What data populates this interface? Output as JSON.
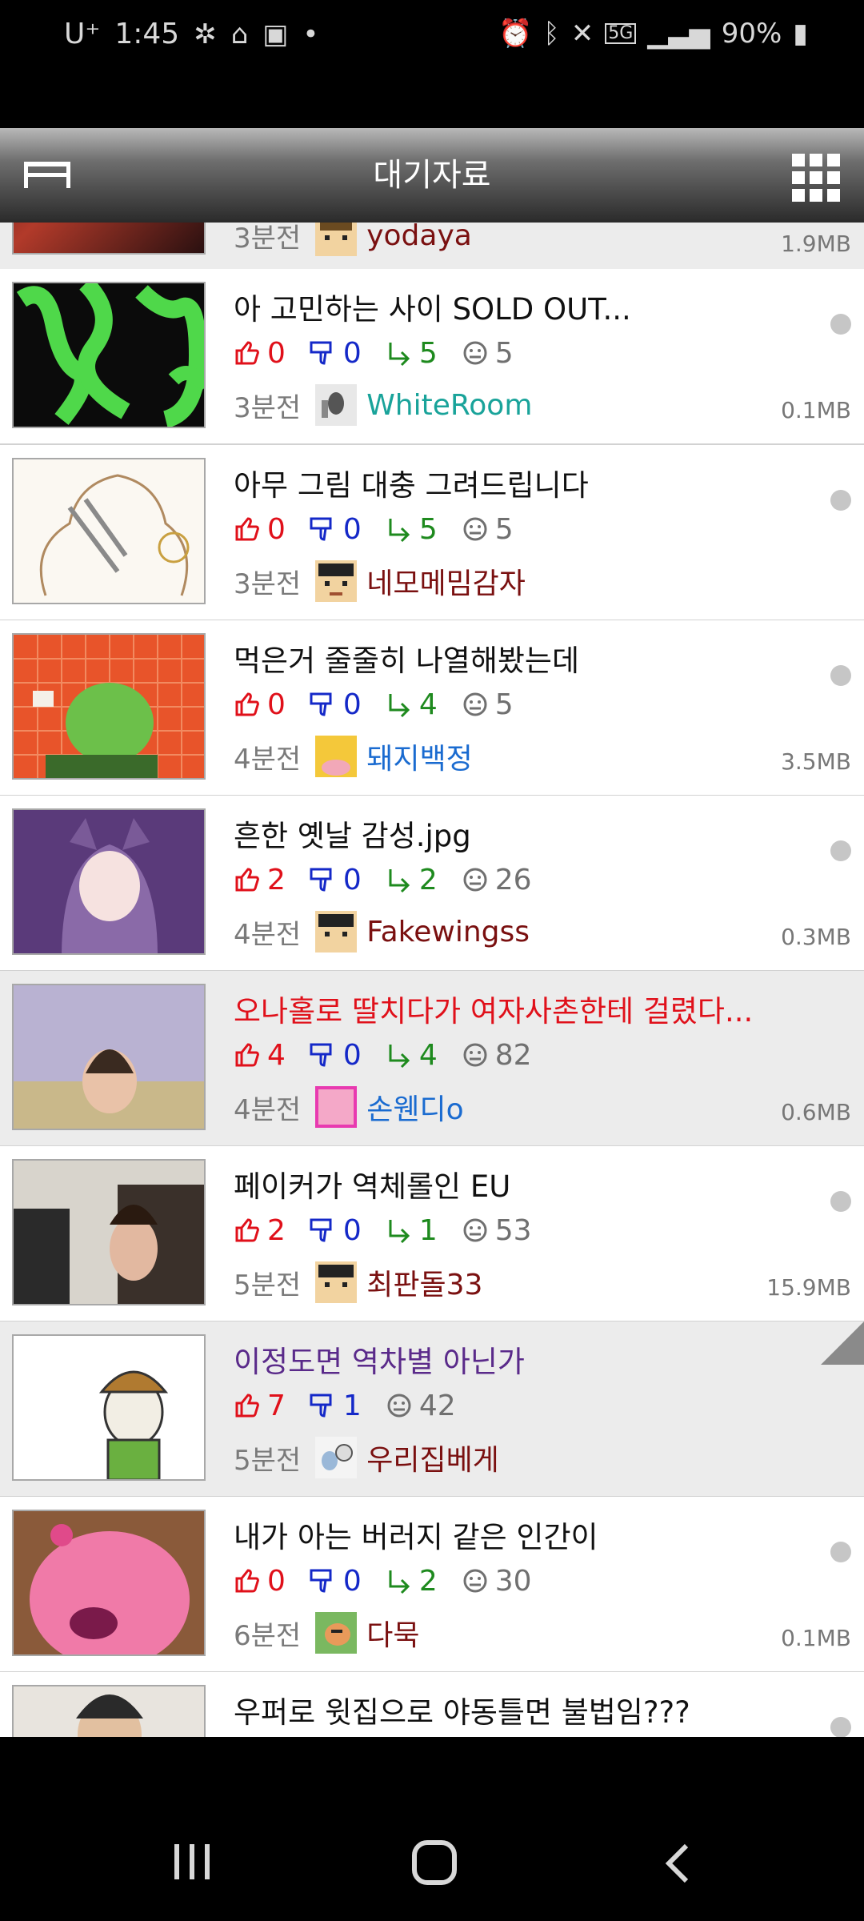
{
  "status_bar": {
    "carrier": "U⁺",
    "time": "1:45",
    "battery": "90%",
    "network": "5G"
  },
  "app_bar": {
    "title": "대기자료"
  },
  "list": {
    "items": [
      {
        "title": "",
        "up": "",
        "down": "",
        "reply": "",
        "views": "",
        "time": "3분전",
        "author": "yodaya",
        "author_color": "#7a1010",
        "size": "1.9MB"
      },
      {
        "title": "아 고민하는 사이 SOLD OUT...",
        "title_color": "#111111",
        "up": "0",
        "down": "0",
        "reply": "5",
        "views": "5",
        "time": "3분전",
        "author": "WhiteRoom",
        "author_color": "#19a39a",
        "size": "0.1MB"
      },
      {
        "title": "아무 그림 대충 그려드립니다",
        "title_color": "#111111",
        "up": "0",
        "down": "0",
        "reply": "5",
        "views": "5",
        "time": "3분전",
        "author": "네모메밈감자",
        "author_color": "#7a1010",
        "size": ""
      },
      {
        "title": "먹은거 줄줄히 나열해봤는데",
        "title_color": "#111111",
        "up": "0",
        "down": "0",
        "reply": "4",
        "views": "5",
        "time": "4분전",
        "author": "돼지백정",
        "author_color": "#1a6bd0",
        "size": "3.5MB"
      },
      {
        "title": "흔한 옛날 감성.jpg",
        "title_color": "#111111",
        "up": "2",
        "down": "0",
        "reply": "2",
        "views": "26",
        "time": "4분전",
        "author": "Fakewingss",
        "author_color": "#7a1010",
        "size": "0.3MB"
      },
      {
        "title": "오나홀로 딸치다가 여자사촌한테 걸렸다...",
        "title_color": "#e0101a",
        "up": "4",
        "down": "0",
        "reply": "4",
        "views": "82",
        "time": "4분전",
        "author": "손웬디o",
        "author_color": "#1a6bd0",
        "size": "0.6MB"
      },
      {
        "title": "페이커가 역체롤인 EU",
        "title_color": "#111111",
        "up": "2",
        "down": "0",
        "reply": "1",
        "views": "53",
        "time": "5분전",
        "author": "최판돌33",
        "author_color": "#7a1010",
        "size": "15.9MB"
      },
      {
        "title": "이정도면 역차별 아닌가",
        "title_color": "#5a2a8a",
        "up": "7",
        "down": "1",
        "reply": "",
        "views": "42",
        "time": "5분전",
        "author": "우리집베게",
        "author_color": "#7a1010",
        "size": ""
      },
      {
        "title": "내가 아는 버러지 같은 인간이",
        "title_color": "#111111",
        "up": "0",
        "down": "0",
        "reply": "2",
        "views": "30",
        "time": "6분전",
        "author": "다묵",
        "author_color": "#7a1010",
        "size": "0.1MB"
      },
      {
        "title": "우퍼로 윗집으로 야동틀면 불법임???",
        "title_color": "#111111",
        "up": "",
        "down": "",
        "reply": "",
        "views": "",
        "time": "",
        "author": "",
        "author_color": "#7a1010",
        "size": ""
      }
    ]
  },
  "icons": {
    "menu": "menu-icon",
    "grid": "grid-icon",
    "thumb_up": "thumb-up-icon",
    "thumb_down": "thumb-down-icon",
    "reply": "reply-icon",
    "view": "view-icon",
    "recents": "recents-icon",
    "home": "home-icon",
    "back": "back-icon"
  }
}
